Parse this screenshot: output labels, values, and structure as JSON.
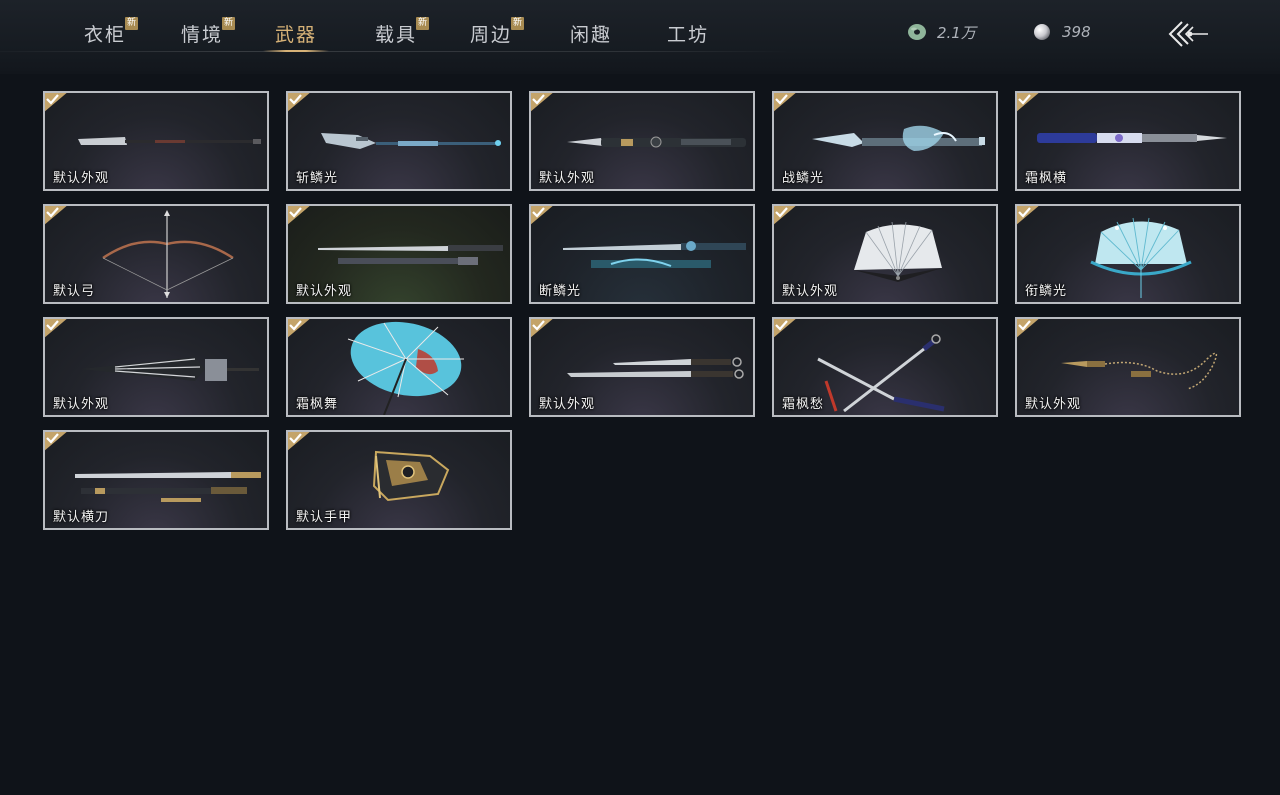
{
  "tabs": [
    {
      "label": "衣柜",
      "new_badge": "新"
    },
    {
      "label": "情境",
      "new_badge": "新"
    },
    {
      "label": "武器",
      "active": true
    },
    {
      "label": "载具",
      "new_badge": "新"
    },
    {
      "label": "周边",
      "new_badge": "新"
    },
    {
      "label": "闲趣"
    },
    {
      "label": "工坊"
    }
  ],
  "currency": {
    "jade": {
      "icon": "jade-coin-icon",
      "value": "2.1万"
    },
    "pearl": {
      "icon": "pearl-icon",
      "value": "398"
    }
  },
  "back_icon": "back-arrow-icon",
  "colors": {
    "accent_gold": "#d7b277",
    "badge": "#a88b52",
    "card_border": "#b9bcc1",
    "background": "#0f1319"
  },
  "weapons": [
    {
      "label": "默认外观",
      "icon": "spear-icon",
      "owned": true
    },
    {
      "label": "斩鳞光",
      "icon": "spear-icon",
      "owned": true
    },
    {
      "label": "默认外观",
      "icon": "lance-icon",
      "owned": true
    },
    {
      "label": "战鳞光",
      "icon": "ornate-lance-icon",
      "owned": true
    },
    {
      "label": "霜枫横",
      "icon": "lance-icon",
      "owned": true
    },
    {
      "label": "默认弓",
      "icon": "bow-icon",
      "owned": true
    },
    {
      "label": "默认外观",
      "icon": "twin-swords-icon",
      "owned": true
    },
    {
      "label": "断鳞光",
      "icon": "twin-swords-icon",
      "owned": true
    },
    {
      "label": "默认外观",
      "icon": "folding-fan-icon",
      "owned": true
    },
    {
      "label": "衔鳞光",
      "icon": "folding-fan-icon",
      "owned": true
    },
    {
      "label": "默认外观",
      "icon": "closed-umbrella-icon",
      "owned": true
    },
    {
      "label": "霜枫舞",
      "icon": "open-umbrella-icon",
      "owned": true
    },
    {
      "label": "默认外观",
      "icon": "dual-blades-icon",
      "owned": true
    },
    {
      "label": "霜枫愁",
      "icon": "crossed-blades-icon",
      "owned": true
    },
    {
      "label": "默认外观",
      "icon": "rope-dart-icon",
      "owned": true
    },
    {
      "label": "默认横刀",
      "icon": "hengdao-icon",
      "owned": true
    },
    {
      "label": "默认手甲",
      "icon": "gauntlet-icon",
      "owned": true
    }
  ]
}
